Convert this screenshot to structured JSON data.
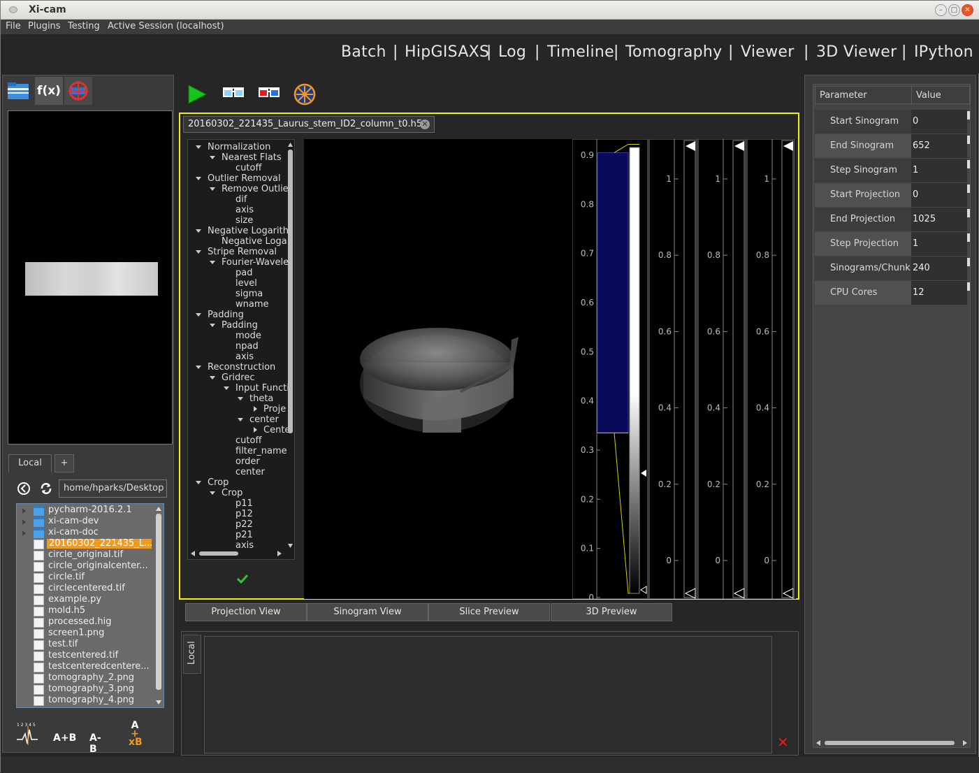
{
  "window": {
    "title": "Xi-cam"
  },
  "menu": [
    "File",
    "Plugins",
    "Testing",
    "Active Session (localhost)"
  ],
  "nav": [
    "Batch",
    "HipGISAXS",
    "Log",
    "Timeline",
    "Tomography",
    "Viewer",
    "3D Viewer",
    "IPython"
  ],
  "filebrowser": {
    "tabs": [
      "Local",
      "+"
    ],
    "path": "home/hparks/Desktop",
    "items": [
      {
        "name": "pycharm-2016.2.1",
        "type": "folder"
      },
      {
        "name": "xi-cam-dev",
        "type": "folder"
      },
      {
        "name": "xi-cam-doc",
        "type": "folder"
      },
      {
        "name": "20160302_221435_L...",
        "type": "file",
        "selected": true
      },
      {
        "name": "circle_original.tif",
        "type": "file"
      },
      {
        "name": "circle_originalcenter...",
        "type": "file"
      },
      {
        "name": "circle.tif",
        "type": "file"
      },
      {
        "name": "circlecentered.tif",
        "type": "file"
      },
      {
        "name": "example.py",
        "type": "file"
      },
      {
        "name": "mold.h5",
        "type": "file"
      },
      {
        "name": "processed.hig",
        "type": "file"
      },
      {
        "name": "screen1.png",
        "type": "file"
      },
      {
        "name": "test.tif",
        "type": "file"
      },
      {
        "name": "testcentered.tif",
        "type": "file"
      },
      {
        "name": "testcenteredcentere...",
        "type": "file"
      },
      {
        "name": "tomography_2.png",
        "type": "file"
      },
      {
        "name": "tomography_3.png",
        "type": "file"
      },
      {
        "name": "tomography_4.png",
        "type": "file"
      }
    ],
    "tools": [
      "A+B",
      "A-B"
    ],
    "tool_peak_label": "1 2 3 4 5",
    "tool_stack": [
      "A",
      "+",
      "xB"
    ]
  },
  "document": {
    "tab": "20160302_221435_Laurus_stem_ID2_column_t0.h5"
  },
  "pipeline": [
    {
      "label": "Normalization",
      "depth": 0,
      "arrow": "down"
    },
    {
      "label": "Nearest Flats",
      "depth": 1,
      "arrow": "down"
    },
    {
      "label": "cutoff",
      "depth": 2,
      "arrow": ""
    },
    {
      "label": "Outlier Removal",
      "depth": 0,
      "arrow": "down"
    },
    {
      "label": "Remove Outlie",
      "depth": 1,
      "arrow": "down"
    },
    {
      "label": "dif",
      "depth": 2,
      "arrow": ""
    },
    {
      "label": "axis",
      "depth": 2,
      "arrow": ""
    },
    {
      "label": "size",
      "depth": 2,
      "arrow": ""
    },
    {
      "label": "Negative Logarith",
      "depth": 0,
      "arrow": "down"
    },
    {
      "label": "Negative Loga",
      "depth": 1,
      "arrow": ""
    },
    {
      "label": "Stripe Removal",
      "depth": 0,
      "arrow": "down"
    },
    {
      "label": "Fourier-Wavelet",
      "depth": 1,
      "arrow": "down"
    },
    {
      "label": "pad",
      "depth": 2,
      "arrow": ""
    },
    {
      "label": "level",
      "depth": 2,
      "arrow": ""
    },
    {
      "label": "sigma",
      "depth": 2,
      "arrow": ""
    },
    {
      "label": "wname",
      "depth": 2,
      "arrow": ""
    },
    {
      "label": "Padding",
      "depth": 0,
      "arrow": "down"
    },
    {
      "label": "Padding",
      "depth": 1,
      "arrow": "down"
    },
    {
      "label": "mode",
      "depth": 2,
      "arrow": ""
    },
    {
      "label": "npad",
      "depth": 2,
      "arrow": ""
    },
    {
      "label": "axis",
      "depth": 2,
      "arrow": ""
    },
    {
      "label": "Reconstruction",
      "depth": 0,
      "arrow": "down"
    },
    {
      "label": "Gridrec",
      "depth": 1,
      "arrow": "down"
    },
    {
      "label": "Input Functi",
      "depth": 2,
      "arrow": "down"
    },
    {
      "label": "theta",
      "depth": 3,
      "arrow": "down"
    },
    {
      "label": "Proje",
      "depth": 4,
      "arrow": "right"
    },
    {
      "label": "center",
      "depth": 3,
      "arrow": "down"
    },
    {
      "label": "Cente",
      "depth": 4,
      "arrow": "right"
    },
    {
      "label": "cutoff",
      "depth": 2,
      "arrow": ""
    },
    {
      "label": "filter_name",
      "depth": 2,
      "arrow": ""
    },
    {
      "label": "order",
      "depth": 2,
      "arrow": ""
    },
    {
      "label": "center",
      "depth": 2,
      "arrow": ""
    },
    {
      "label": "Crop",
      "depth": 0,
      "arrow": "down"
    },
    {
      "label": "Crop",
      "depth": 1,
      "arrow": "down"
    },
    {
      "label": "p11",
      "depth": 2,
      "arrow": ""
    },
    {
      "label": "p12",
      "depth": 2,
      "arrow": ""
    },
    {
      "label": "p22",
      "depth": 2,
      "arrow": ""
    },
    {
      "label": "p21",
      "depth": 2,
      "arrow": ""
    },
    {
      "label": "axis",
      "depth": 2,
      "arrow": ""
    }
  ],
  "histogram": {
    "main_ticks": [
      "0.9",
      "0.8",
      "0.7",
      "0.6",
      "0.5",
      "0.4",
      "0.3",
      "0.2",
      "0.1",
      "0"
    ],
    "channel_ticks": [
      "1",
      "0.8",
      "0.6",
      "0.4",
      "0.2",
      "0"
    ],
    "region_fraction": [
      0.335,
      0.905
    ]
  },
  "viewtabs": [
    "Projection View",
    "Sinogram View",
    "Slice Preview",
    "3D Preview"
  ],
  "console": {
    "tab": "Local"
  },
  "params": {
    "headers": [
      "Parameter",
      "Value"
    ],
    "rows": [
      {
        "name": "Start Sinogram",
        "value": "0"
      },
      {
        "name": "End Sinogram",
        "value": "652"
      },
      {
        "name": "Step Sinogram",
        "value": "1"
      },
      {
        "name": "Start Projection",
        "value": "0"
      },
      {
        "name": "End Projection",
        "value": "1025"
      },
      {
        "name": "Step Projection",
        "value": "1"
      },
      {
        "name": "Sinograms/Chunk",
        "value": "240"
      },
      {
        "name": "CPU Cores",
        "value": "12"
      }
    ]
  },
  "colors": {
    "accent_frame": "#f5f000",
    "selection": "#f39a1e",
    "region": "#0a0a5a",
    "error": "#e02020"
  }
}
